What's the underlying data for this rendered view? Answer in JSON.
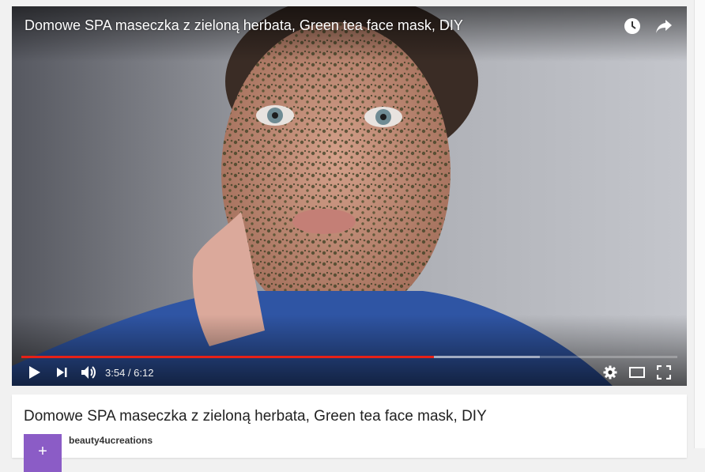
{
  "player": {
    "overlay_title": "Domowe SPA maseczka z zieloną herbata, Green tea face mask, DIY",
    "time_display": "3:54 / 6:12",
    "played_fraction": 0.629,
    "loaded_fraction": 0.79,
    "top_icons": [
      "clock-icon",
      "share-icon"
    ],
    "control_icons": [
      "play-icon",
      "next-icon",
      "volume-icon",
      "gear-icon",
      "theater-mode-icon",
      "fullscreen-icon"
    ]
  },
  "info": {
    "title": "Domowe SPA maseczka z zieloną herbata, Green tea face mask, DIY",
    "channel_name": "beauty4ucreations",
    "avatar_letter": "+"
  },
  "colors": {
    "progress_red": "#e62117",
    "avatar_purple": "#8b5cc6",
    "mask_green": "#3b3f22",
    "shirt_blue": "#2f55a4"
  }
}
